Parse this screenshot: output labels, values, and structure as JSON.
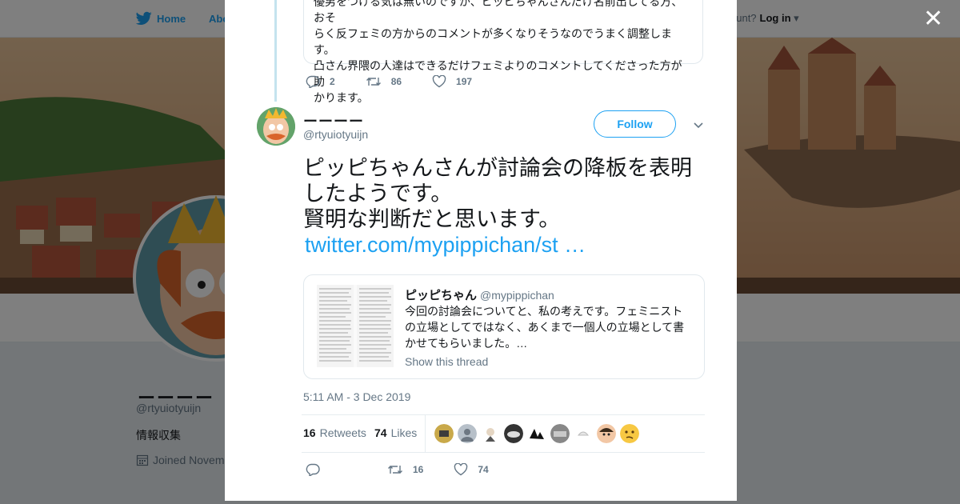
{
  "nav": {
    "home_label": "Home",
    "about_label": "Abo",
    "account_prompt": "ccount?",
    "login_label": "Log in"
  },
  "profile": {
    "name": "ーーーー",
    "handle": "@rtyuiotyuijn",
    "bio": "情報収集",
    "joined": "Joined Novem"
  },
  "thread": {
    "previous_text_lines": [
      "優男をつける気は無いのですが、ピッピちゃんさんだけ名前出してる方、おそ",
      "らく反フェミの方からのコメントが多くなりそうなのでうまく調整します。",
      "凸さん界隈の人達はできるだけフェミよりのコメントしてくださった方が助",
      "かります。"
    ],
    "previous_actions": {
      "replies": "2",
      "retweets": "86",
      "likes": "197"
    }
  },
  "tweet": {
    "author_name": "ーーーー",
    "author_handle": "@rtyuiotyuijn",
    "follow_label": "Follow",
    "text_lines": [
      "ピッピちゃんさんが討論会の降板を表明",
      "したようです。",
      "賢明な判断だと思います。"
    ],
    "link": "twitter.com/mypippichan/st …",
    "quoted": {
      "name": "ピッピちゃん",
      "handle": "@mypippichan",
      "text_lines": [
        "今回の討論会についてと、私の考えです。フェミニスト",
        "の立場としてではなく、あくまで一個人の立場として書",
        "かせてもらいました。…"
      ],
      "show_thread": "Show this thread"
    },
    "timestamp": "5:11 AM - 3 Dec 2019",
    "retweet_count": "16",
    "retweets_label": "Retweets",
    "like_count": "74",
    "likes_label": "Likes",
    "actions": {
      "replies": "",
      "retweets": "16",
      "likes": "74"
    }
  },
  "colors": {
    "accent": "#1da1f2",
    "thread_line": "#c4e3ee"
  }
}
